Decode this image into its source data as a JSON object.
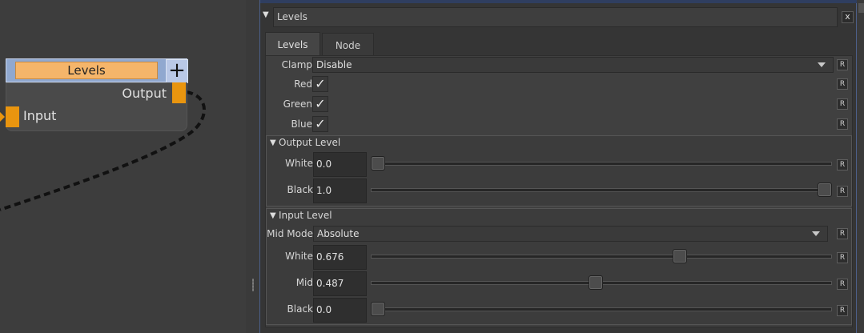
{
  "graph": {
    "node": {
      "title": "Levels",
      "add_symbol": "+",
      "output_label": "Output",
      "input_label": "Input",
      "header_color": "#90a8cf",
      "title_color": "#f5b56a",
      "port_color": "#e9950f"
    }
  },
  "panel": {
    "title": "Levels",
    "close_label": "x",
    "tabs": [
      {
        "label": "Levels",
        "active": true
      },
      {
        "label": "Node",
        "active": false
      }
    ],
    "reset_label": "R",
    "clamp": {
      "label": "Clamp",
      "value": "Disable"
    },
    "channels": [
      {
        "label": "Red",
        "checked": true
      },
      {
        "label": "Green",
        "checked": true
      },
      {
        "label": "Blue",
        "checked": true
      }
    ],
    "check_glyph": "✓",
    "output_level": {
      "title": "Output Level",
      "white": {
        "label": "White",
        "value": "0.0",
        "fraction": 0.0
      },
      "black": {
        "label": "Black",
        "value": "1.0",
        "fraction": 1.0
      }
    },
    "input_level": {
      "title": "Input Level",
      "mid_mode": {
        "label": "Mid Mode",
        "value": "Absolute"
      },
      "white": {
        "label": "White",
        "value": "0.676",
        "fraction": 0.676
      },
      "mid": {
        "label": "Mid",
        "value": "0.487",
        "fraction": 0.487
      },
      "black": {
        "label": "Black",
        "value": "0.0",
        "fraction": 0.0
      }
    }
  }
}
